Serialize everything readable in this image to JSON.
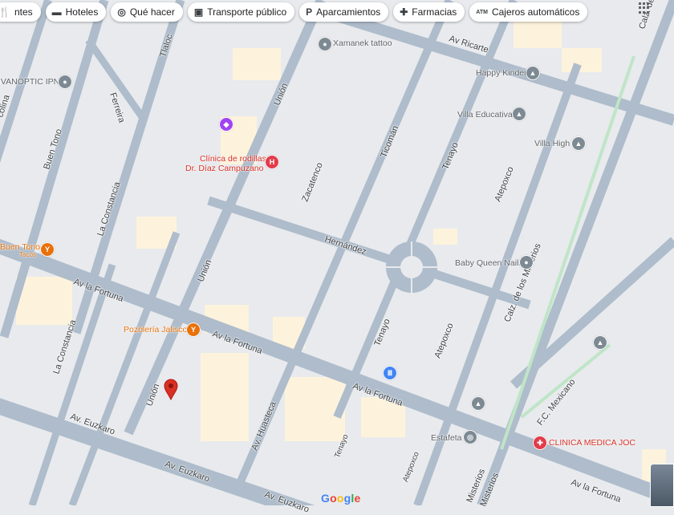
{
  "chips": [
    {
      "icon": "fork-knife-icon",
      "label": "ntes"
    },
    {
      "icon": "bed-icon",
      "label": "Hoteles"
    },
    {
      "icon": "camera-icon",
      "label": "Qué hacer"
    },
    {
      "icon": "bus-icon",
      "label": "Transporte público"
    },
    {
      "icon": "parking-icon",
      "label": "Aparcamientos"
    },
    {
      "icon": "pharmacy-icon",
      "label": "Farmacias"
    },
    {
      "icon": "atm-icon",
      "label": "Cajeros automáticos"
    }
  ],
  "chip_glyphs": [
    "🍴",
    "▬",
    "◎",
    "▣",
    "P",
    "✚",
    "ATM"
  ],
  "streets": {
    "av_ricarte": "Av Ricarte",
    "tlalpan_left": "Tlaloc",
    "ferreira": "Ferreira",
    "union_top": "Unión",
    "union_mid": "Unión",
    "union_low": "Unión",
    "buen_tono": "Buen Tono",
    "la_constancia_top": "La Constancia",
    "la_constancia_low": "La Constancia",
    "zacatenco": "Zacatenco",
    "ticoman": "Ticomán",
    "tenayo_top": "Tenayo",
    "tenayo_mid": "Tenayo",
    "tenayo_low": "Tenayo",
    "atepoxco_top": "Atepoxco",
    "atepoxco_mid": "Atepoxco",
    "atepoxco_low": "Atepoxco",
    "hernandez": "Hernández",
    "av_la_fortuna_left": "Av la Fortuna",
    "av_la_fortuna_mid": "Av la Fortuna",
    "av_la_fortuna_right": "Av la Fortuna",
    "av_la_fortuna_far": "Av la Fortuna",
    "calz_misterios": "Calz. de los Misterios",
    "misterios_low": "Misterios",
    "misterios_low2": "Misterios",
    "av_huasteca": "Av. Huasteca",
    "av_euzkaro_1": "Av. Euzkaro",
    "av_euzkaro_2": "Av. Euzkaro",
    "av_euzkaro_3": "Av. Euzkaro",
    "fc_mexicano": "F.C. Mexicano",
    "calz_de": "Calz. de",
    "colina": "colina"
  },
  "pois": {
    "xamanek": "Xamanek tattoo",
    "happy_kinder": "Happy Kinder",
    "villa_educativa": "Villa Educativa",
    "villa_high": "Villa High",
    "clinica_rodillas_1": "Clínica de rodillas",
    "clinica_rodillas_2": "Dr. Díaz Campuzano",
    "vanoptic": "IVANOPTIC IPN",
    "buen_tono": "Buen Tono",
    "buen_tono_sub": "Tacos",
    "baby_queen": "Baby Queen Nails",
    "pozoleria": "Pozolería Jalisco",
    "estafeta": "Estafeta",
    "clinica_joc": "CLINICA MEDICA JOC"
  },
  "google_letters": [
    "G",
    "o",
    "o",
    "g",
    "l",
    "e"
  ],
  "colors": {
    "road": "#aebccb",
    "road_edge": "#c6d1dc",
    "block": "#e8eaed",
    "building": "#dadce0",
    "commercial": "#fdf3dc",
    "green": "#bfe5c7",
    "pin_red": "#d93025",
    "poi_gray": "#7d8a93",
    "poi_orange": "#e8710a",
    "poi_purple": "#a142f4",
    "poi_blue": "#4285f4"
  }
}
